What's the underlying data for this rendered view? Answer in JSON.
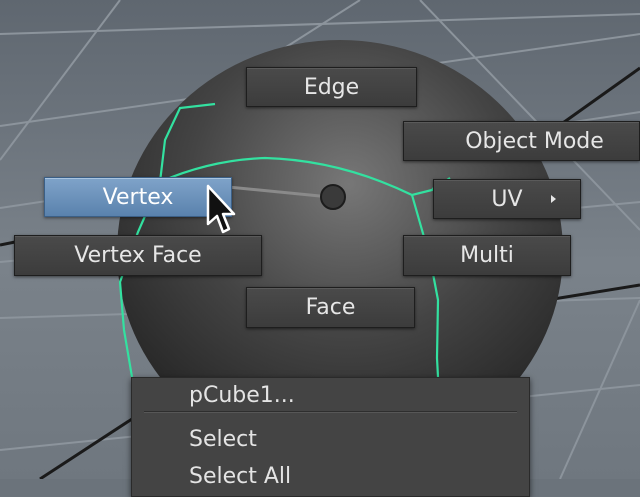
{
  "marking_menu": {
    "north": "Edge",
    "northeast": "Object Mode",
    "west": "Vertex",
    "east": "UV",
    "southwest": "Vertex Face",
    "southeast": "Multi",
    "south": "Face",
    "active_item": "Vertex"
  },
  "context_menu": {
    "object_name": "pCube1...",
    "items": [
      "Select",
      "Select All"
    ]
  },
  "colors": {
    "active_highlight": "#6b8fb9",
    "wireframe": "#33e1a0",
    "button_bg": "#424242"
  },
  "icons": {
    "cursor": "pointer-arrow-icon",
    "submenu": "submenu-arrow-icon",
    "center": "marking-menu-center-icon"
  }
}
